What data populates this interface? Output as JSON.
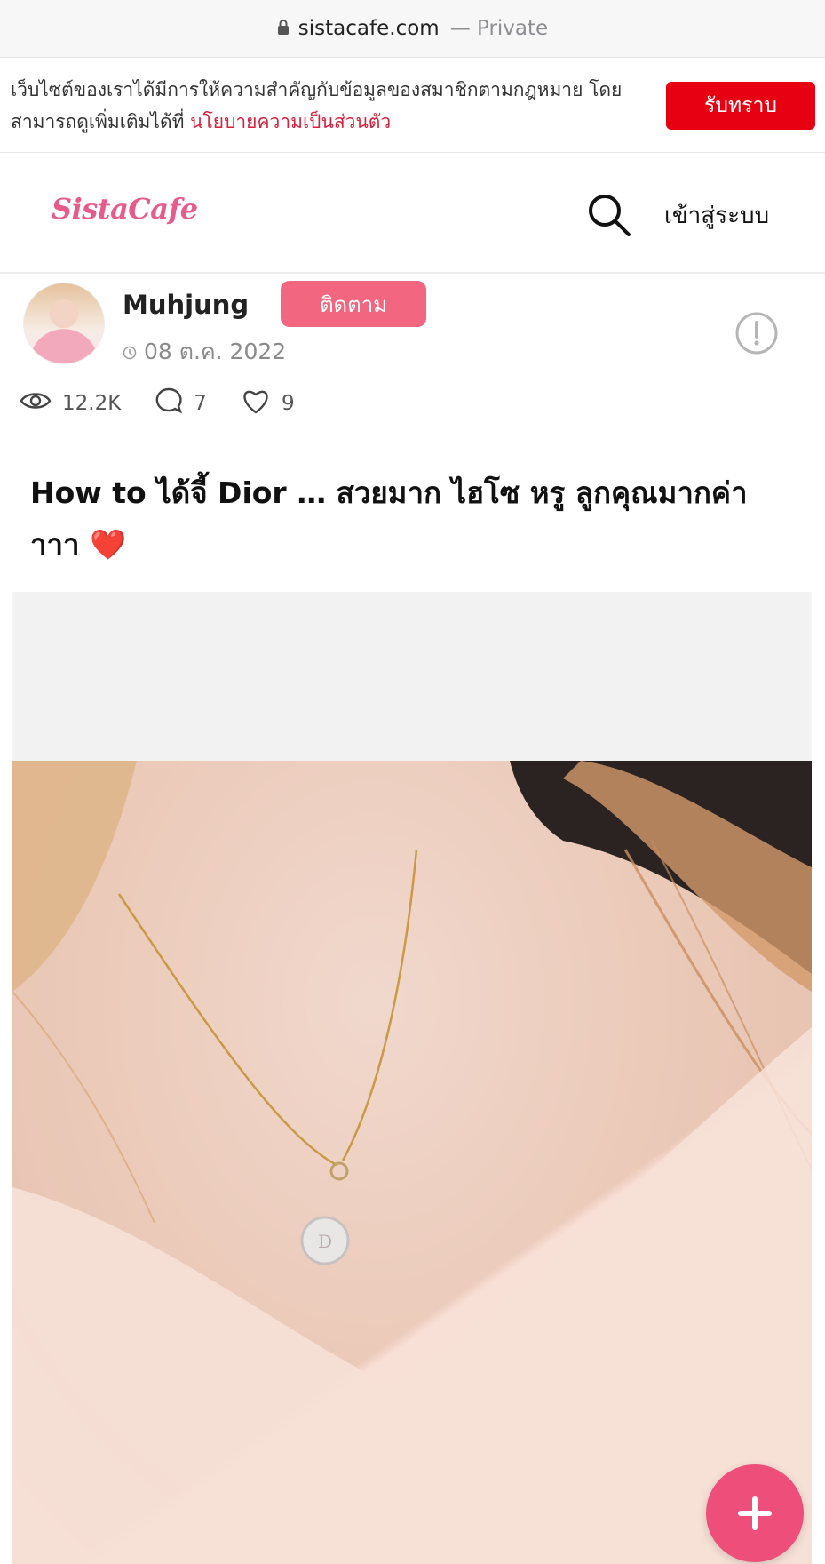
{
  "browser": {
    "domain": "sistacafe.com",
    "separator": "—",
    "privacy": "Private"
  },
  "cookie_banner": {
    "text": "เว็บไซต์ของเราได้มีการให้ความสำคัญกับข้อมูลของสมาชิกตามกฎหมาย โดยสามารถดูเพิ่มเติมได้ที่ ",
    "link_text": "นโยบายความเป็นส่วนตัว",
    "accept_label": "รับทราบ"
  },
  "header": {
    "logo": "SistaCafe",
    "login_label": "เข้าสู่ระบบ",
    "search_icon": "search-icon"
  },
  "author": {
    "name": "Muhjung",
    "follow_label": "ติดตาม",
    "date": "08 ต.ค. 2022"
  },
  "stats": {
    "views": "12.2K",
    "comments": "7",
    "likes": "9"
  },
  "post": {
    "title": "How to ได้จี้ Dior … สวยมาก ไฮโซ หรู ลูกคุณมากค่าาาา ❤️"
  },
  "colors": {
    "brand_pink": "#e75b8c",
    "accept_red": "#e60011",
    "follow_pink": "#f2667f",
    "fab_pink": "#ee4f7a"
  }
}
